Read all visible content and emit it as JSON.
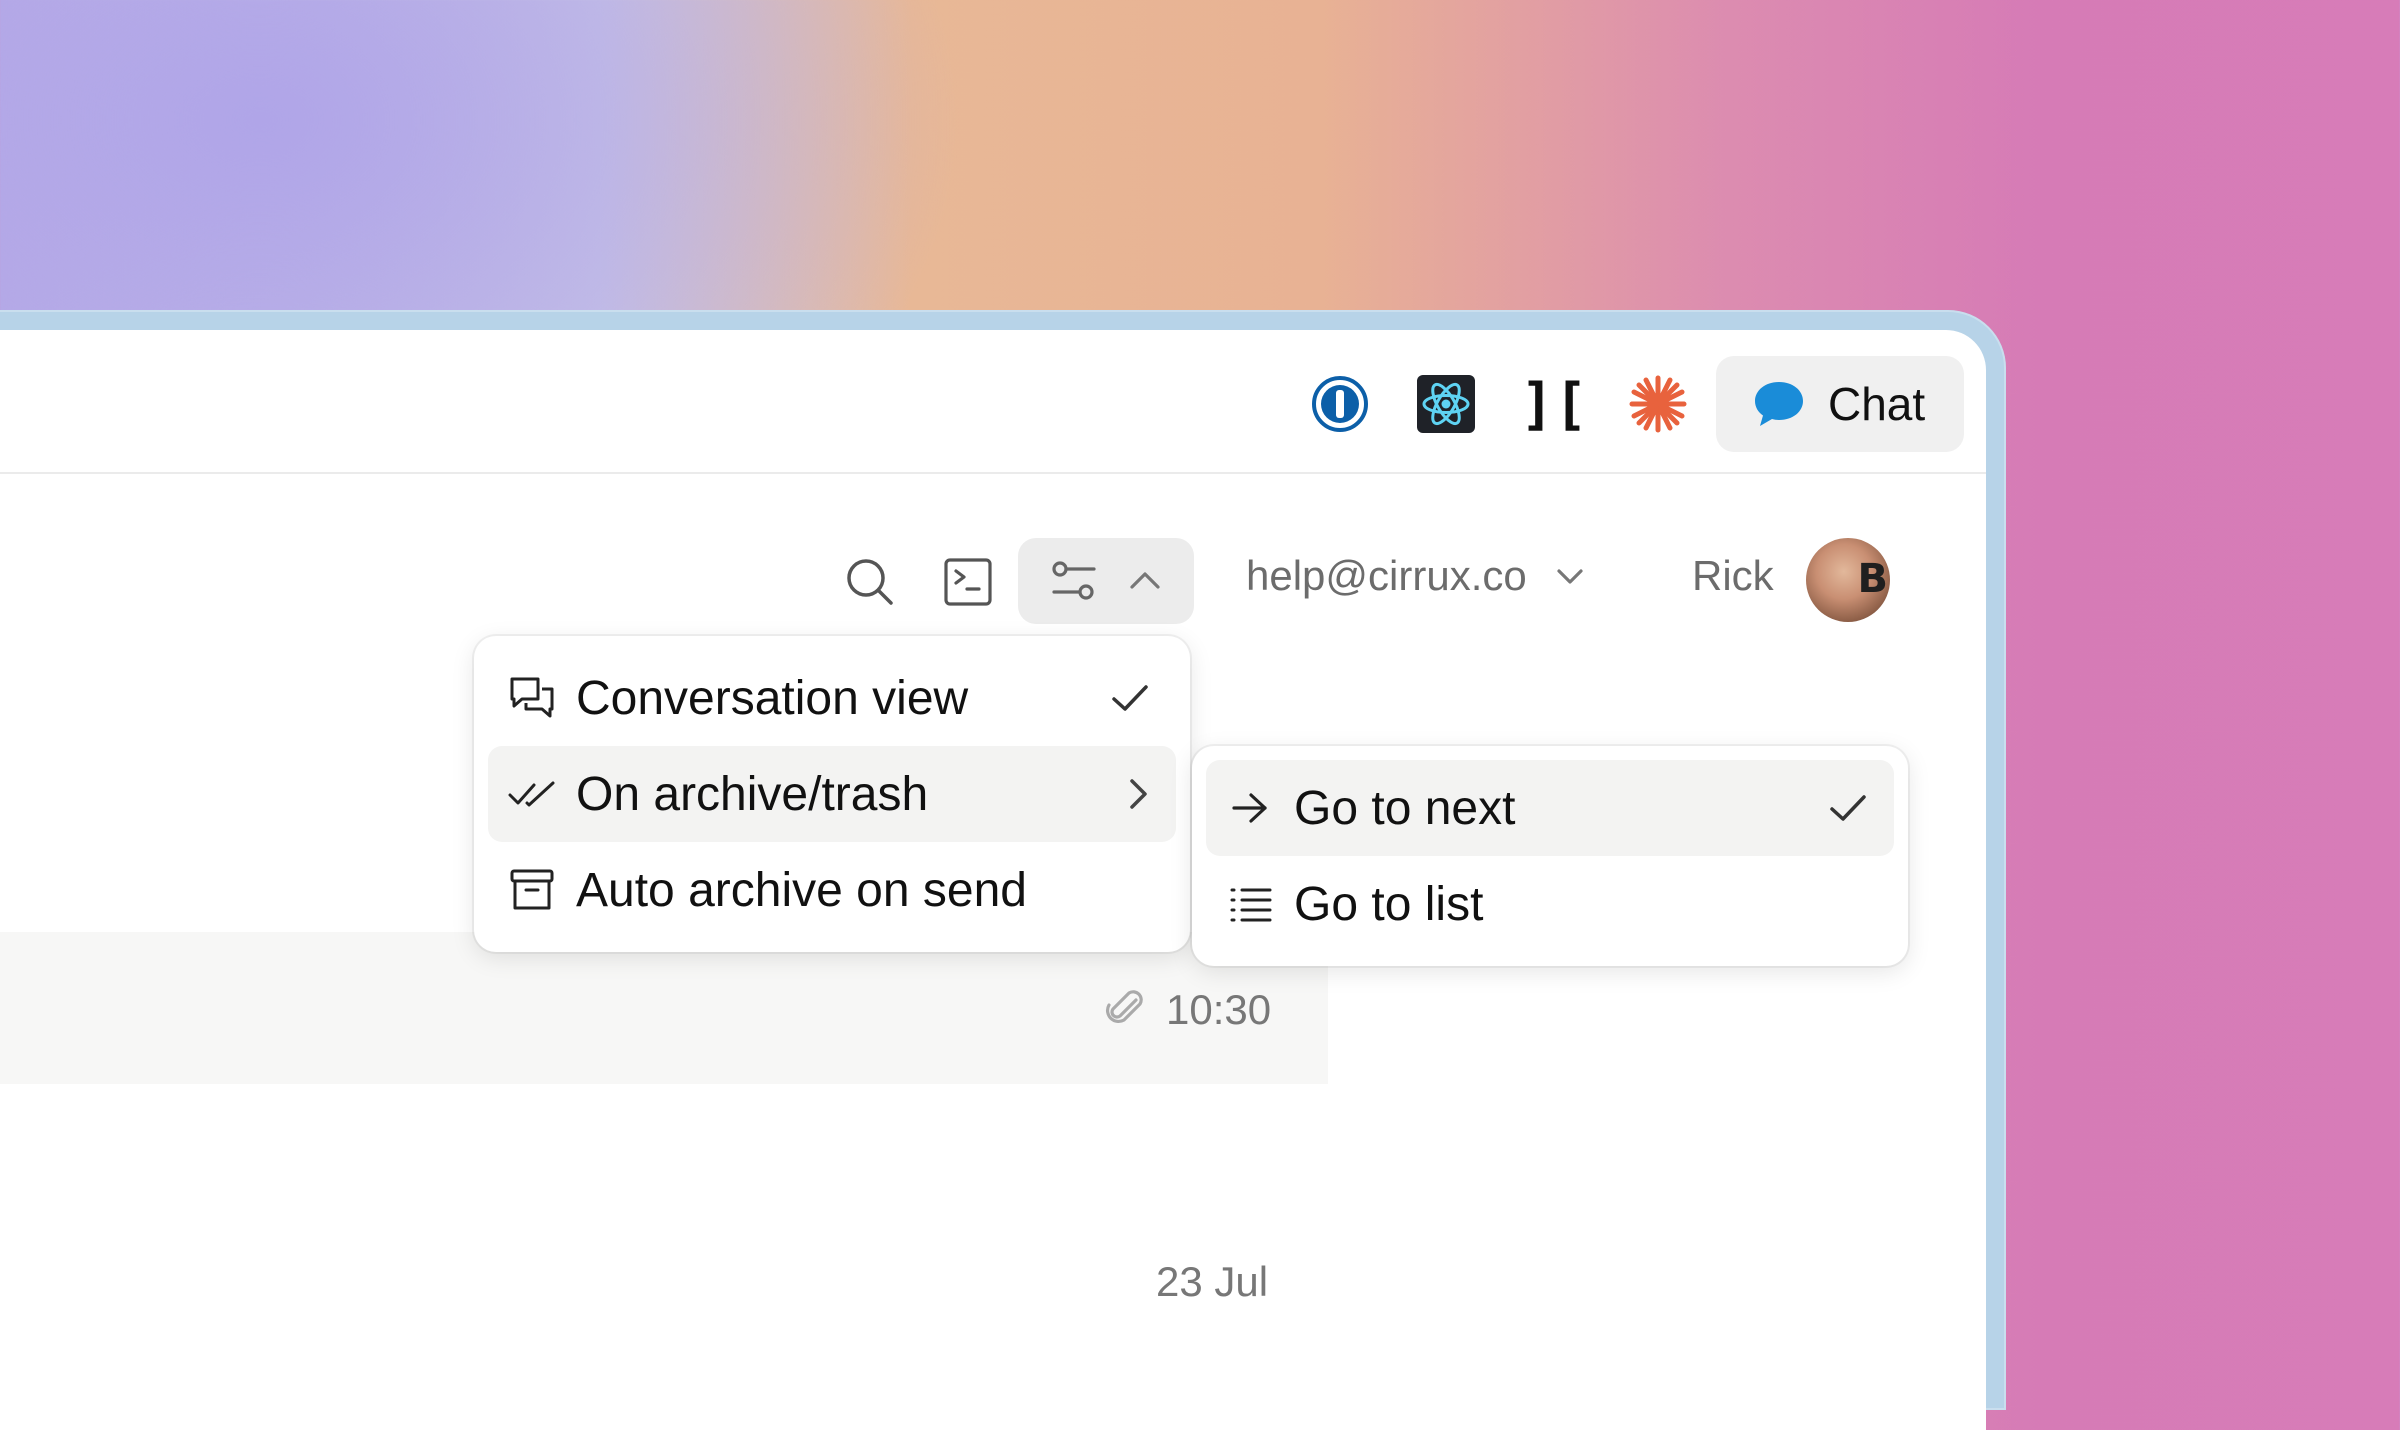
{
  "topbar": {
    "extensions": [
      {
        "name": "1password",
        "icon": "onepassword-icon"
      },
      {
        "name": "react-devtools",
        "icon": "react-icon"
      },
      {
        "name": "ext-bracket-heart",
        "icon": "bracket-heart-icon",
        "glyph_left": "]",
        "glyph_right": "["
      },
      {
        "name": "claude",
        "icon": "sparkle-icon"
      }
    ],
    "chat_label": "Chat"
  },
  "header": {
    "account_email": "help@cirrux.co",
    "user_name": "Rick",
    "avatar_letter": "B"
  },
  "list": {
    "row_time": "10:30",
    "date_label": "23 Jul"
  },
  "settings_menu": {
    "items": [
      {
        "label": "Conversation view",
        "icon": "conversation-icon",
        "checked": true
      },
      {
        "label": "On archive/trash",
        "icon": "double-check-icon",
        "submenu": true,
        "highlighted": true
      },
      {
        "label": "Auto archive on send",
        "icon": "archive-box-icon"
      }
    ]
  },
  "archive_submenu": {
    "items": [
      {
        "label": "Go to next",
        "icon": "arrow-right-icon",
        "checked": true,
        "highlighted": true
      },
      {
        "label": "Go to list",
        "icon": "list-icon"
      }
    ]
  },
  "colors": {
    "chat_icon": "#1a8cd8",
    "sparkle": "#e8623d",
    "react_cyan": "#5ed3f3",
    "muted_text": "#6c6c6c"
  }
}
